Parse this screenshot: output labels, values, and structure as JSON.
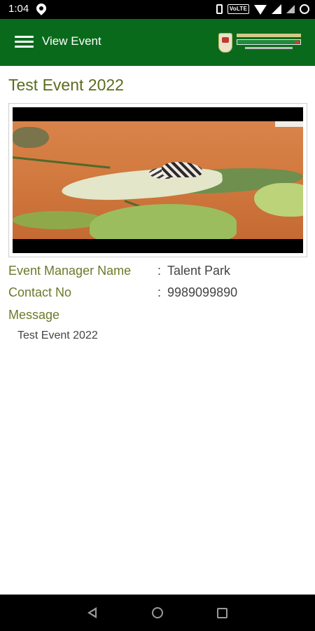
{
  "status_bar": {
    "time": "1:04",
    "network_label": "VoLTE"
  },
  "app_bar": {
    "title": "View Event",
    "menu_icon": "hamburger-menu-icon",
    "logo": "school-logo"
  },
  "event": {
    "title": "Test Event 2022",
    "image_alt": "butterfly-on-leaves-photo",
    "fields": {
      "manager_label": "Event Manager Name",
      "manager_value": "Talent Park",
      "contact_label": "Contact No",
      "contact_value": "9989099890",
      "separator": ":"
    },
    "message_label": "Message",
    "message_text": "Test Event 2022"
  },
  "nav_bar": {
    "back_icon": "back-triangle-icon",
    "home_icon": "home-circle-icon",
    "recents_icon": "recents-square-icon"
  },
  "colors": {
    "app_bar": "#0a6a1c",
    "label_text": "#6b7a2a",
    "value_text": "#444444"
  }
}
